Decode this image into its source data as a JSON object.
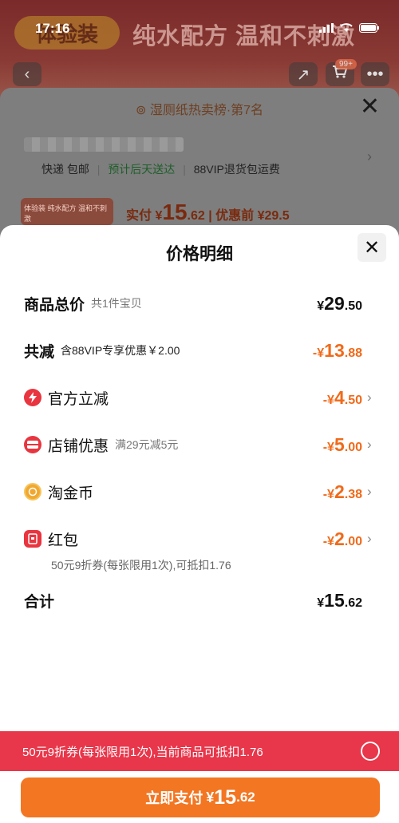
{
  "status_bar": {
    "time": "17:16",
    "signal_icon": "signal-icon",
    "wifi_icon": "wifi-icon",
    "battery_icon": "battery-icon"
  },
  "background": {
    "hero_pill": "体验装",
    "hero_text": "纯水配方 温和不刺激",
    "cart_badge": "99+",
    "rank_label": "湿厕纸热卖榜·第7名",
    "shipping": {
      "method": "快递 包邮",
      "eta": "预计后天送达",
      "return": "88VIP退货包运费"
    },
    "mini_thumb_text": "体验装 纯水配方 温和不刺激",
    "price_prefix": "实付",
    "price_currency": "¥",
    "price_int": "15",
    "price_dec": ".62",
    "price_before": "| 优惠前 ¥29.5"
  },
  "sheet": {
    "title": "价格明细",
    "rows": {
      "total": {
        "label": "商品总价",
        "hint": "共1件宝贝",
        "cur": "¥",
        "int": "29",
        "dec": ".50"
      },
      "reduce": {
        "label": "共减",
        "hint": "含88VIP专享优惠￥2.00",
        "cur": "-¥",
        "int": "13",
        "dec": ".88"
      },
      "official": {
        "label": "官方立减",
        "cur": "-¥",
        "int": "4",
        "dec": ".50"
      },
      "store": {
        "label": "店铺优惠",
        "hint": "满29元减5元",
        "cur": "-¥",
        "int": "5",
        "dec": ".00"
      },
      "coins": {
        "label": "淘金币",
        "cur": "-¥",
        "int": "2",
        "dec": ".38"
      },
      "redpacket": {
        "label": "红包",
        "cur": "-¥",
        "int": "2",
        "dec": ".00",
        "note": "50元9折券(每张限用1次),可抵扣1.76"
      },
      "sum": {
        "label": "合计",
        "cur": "¥",
        "int": "15",
        "dec": ".62"
      }
    },
    "coupon_bar": "50元9折券(每张限用1次),当前商品可抵扣1.76",
    "pay_button": {
      "label": "立即支付",
      "cur": "¥",
      "int": "15",
      "dec": ".62"
    }
  },
  "colors": {
    "accent_orange": "#f06a1a",
    "pay_button": "#f37622",
    "coupon_bar": "#e8364a",
    "icon_red": "#e8353f",
    "coin_gold": "#f0a830"
  }
}
